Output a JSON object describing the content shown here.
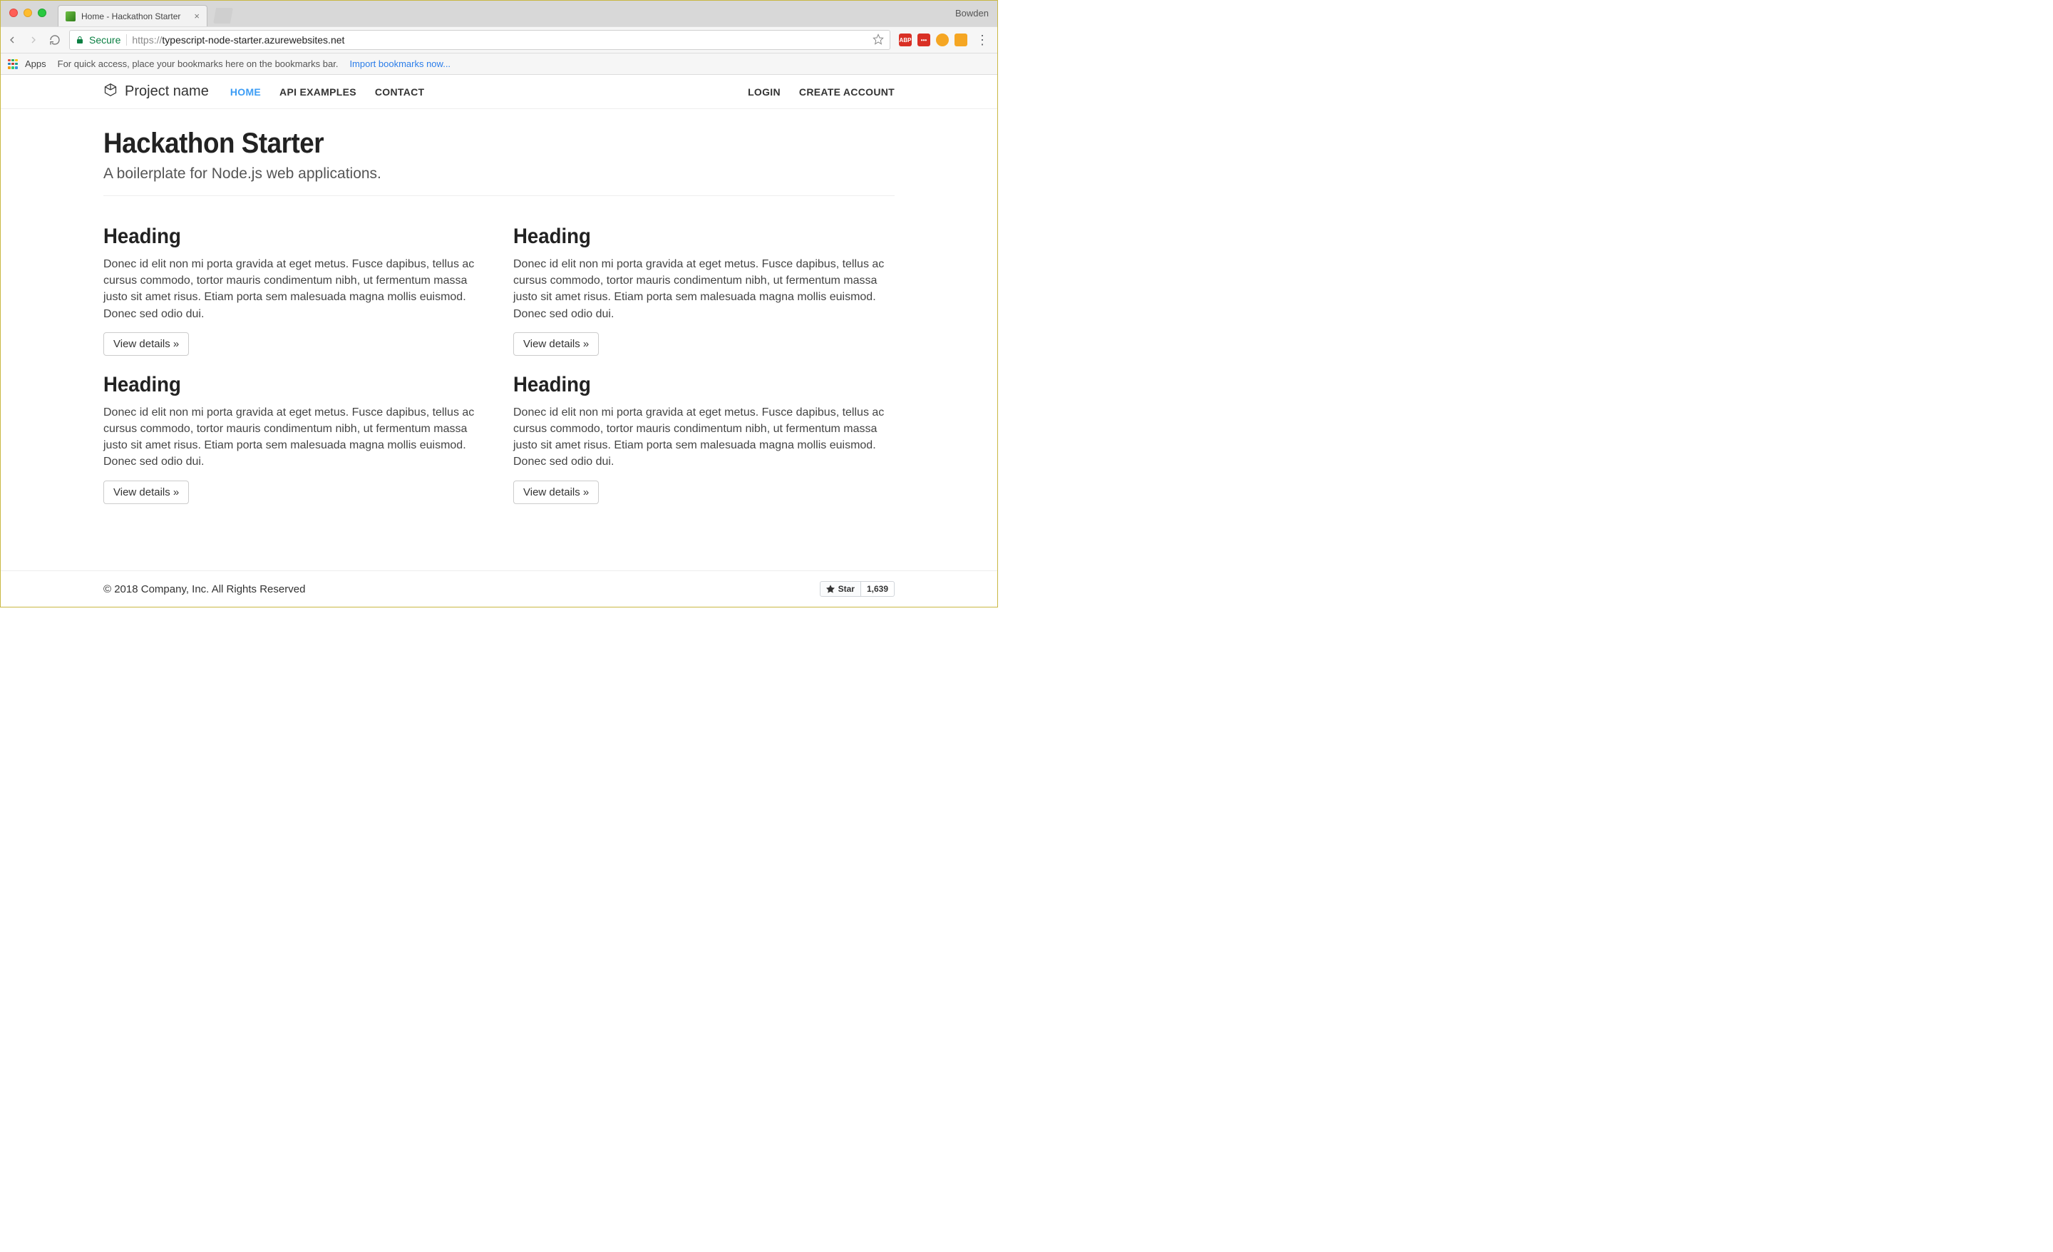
{
  "browser": {
    "profile": "Bowden",
    "tab": {
      "title": "Home - Hackathon Starter"
    },
    "secure_label": "Secure",
    "url_scheme": "https://",
    "url_host": "typescript-node-starter.azurewebsites.net",
    "apps_label": "Apps",
    "bookmarks_hint": "For quick access, place your bookmarks here on the bookmarks bar.",
    "import_link": "Import bookmarks now...",
    "ext_abp": "ABP"
  },
  "navbar": {
    "brand": "Project name",
    "links": [
      "HOME",
      "API EXAMPLES",
      "CONTACT"
    ],
    "right": [
      "LOGIN",
      "CREATE ACCOUNT"
    ]
  },
  "hero": {
    "title": "Hackathon Starter",
    "subtitle": "A boilerplate for Node.js web applications."
  },
  "cards": [
    {
      "heading": "Heading",
      "body": "Donec id elit non mi porta gravida at eget metus. Fusce dapibus, tellus ac cursus commodo, tortor mauris condimentum nibh, ut fermentum massa justo sit amet risus. Etiam porta sem malesuada magna mollis euismod. Donec sed odio dui.",
      "button": "View details »"
    },
    {
      "heading": "Heading",
      "body": "Donec id elit non mi porta gravida at eget metus. Fusce dapibus, tellus ac cursus commodo, tortor mauris condimentum nibh, ut fermentum massa justo sit amet risus. Etiam porta sem malesuada magna mollis euismod. Donec sed odio dui.",
      "button": "View details »"
    },
    {
      "heading": "Heading",
      "body": "Donec id elit non mi porta gravida at eget metus. Fusce dapibus, tellus ac cursus commodo, tortor mauris condimentum nibh, ut fermentum massa justo sit amet risus. Etiam porta sem malesuada magna mollis euismod. Donec sed odio dui.",
      "button": "View details »"
    },
    {
      "heading": "Heading",
      "body": "Donec id elit non mi porta gravida at eget metus. Fusce dapibus, tellus ac cursus commodo, tortor mauris condimentum nibh, ut fermentum massa justo sit amet risus. Etiam porta sem malesuada magna mollis euismod. Donec sed odio dui.",
      "button": "View details »"
    }
  ],
  "footer": {
    "copyright": "© 2018 Company, Inc. All Rights Reserved",
    "star_label": "Star",
    "star_count": "1,639"
  }
}
